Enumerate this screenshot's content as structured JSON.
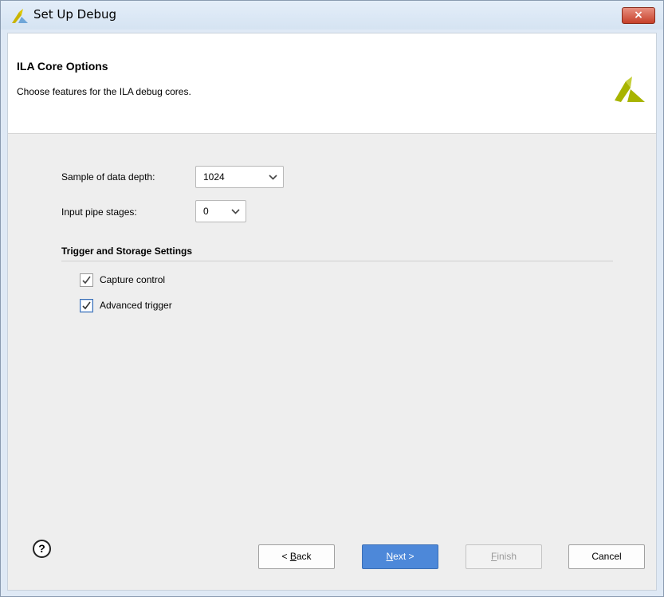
{
  "window": {
    "title": "Set Up Debug",
    "close_label": "×"
  },
  "header": {
    "title": "ILA Core Options",
    "subtitle": "Choose features for the ILA debug cores."
  },
  "options": {
    "sample_depth_label": "Sample of data depth:",
    "sample_depth_value": "1024",
    "pipe_stages_label": "Input pipe stages:",
    "pipe_stages_value": "0"
  },
  "trigger_section": {
    "title": "Trigger and Storage Settings",
    "capture_control": {
      "label": "Capture control",
      "checked": true
    },
    "advanced_trigger": {
      "label": "Advanced trigger",
      "checked": true
    }
  },
  "footer": {
    "help_label": "?",
    "back_prefix": "< ",
    "back_mnemonic": "B",
    "back_rest": "ack",
    "next_mnemonic": "N",
    "next_rest": "ext >",
    "finish_mnemonic": "F",
    "finish_rest": "inish",
    "cancel_label": "Cancel"
  },
  "colors": {
    "accent": "#4d88d9",
    "logo": "#a8b400",
    "close": "#c6402a"
  }
}
